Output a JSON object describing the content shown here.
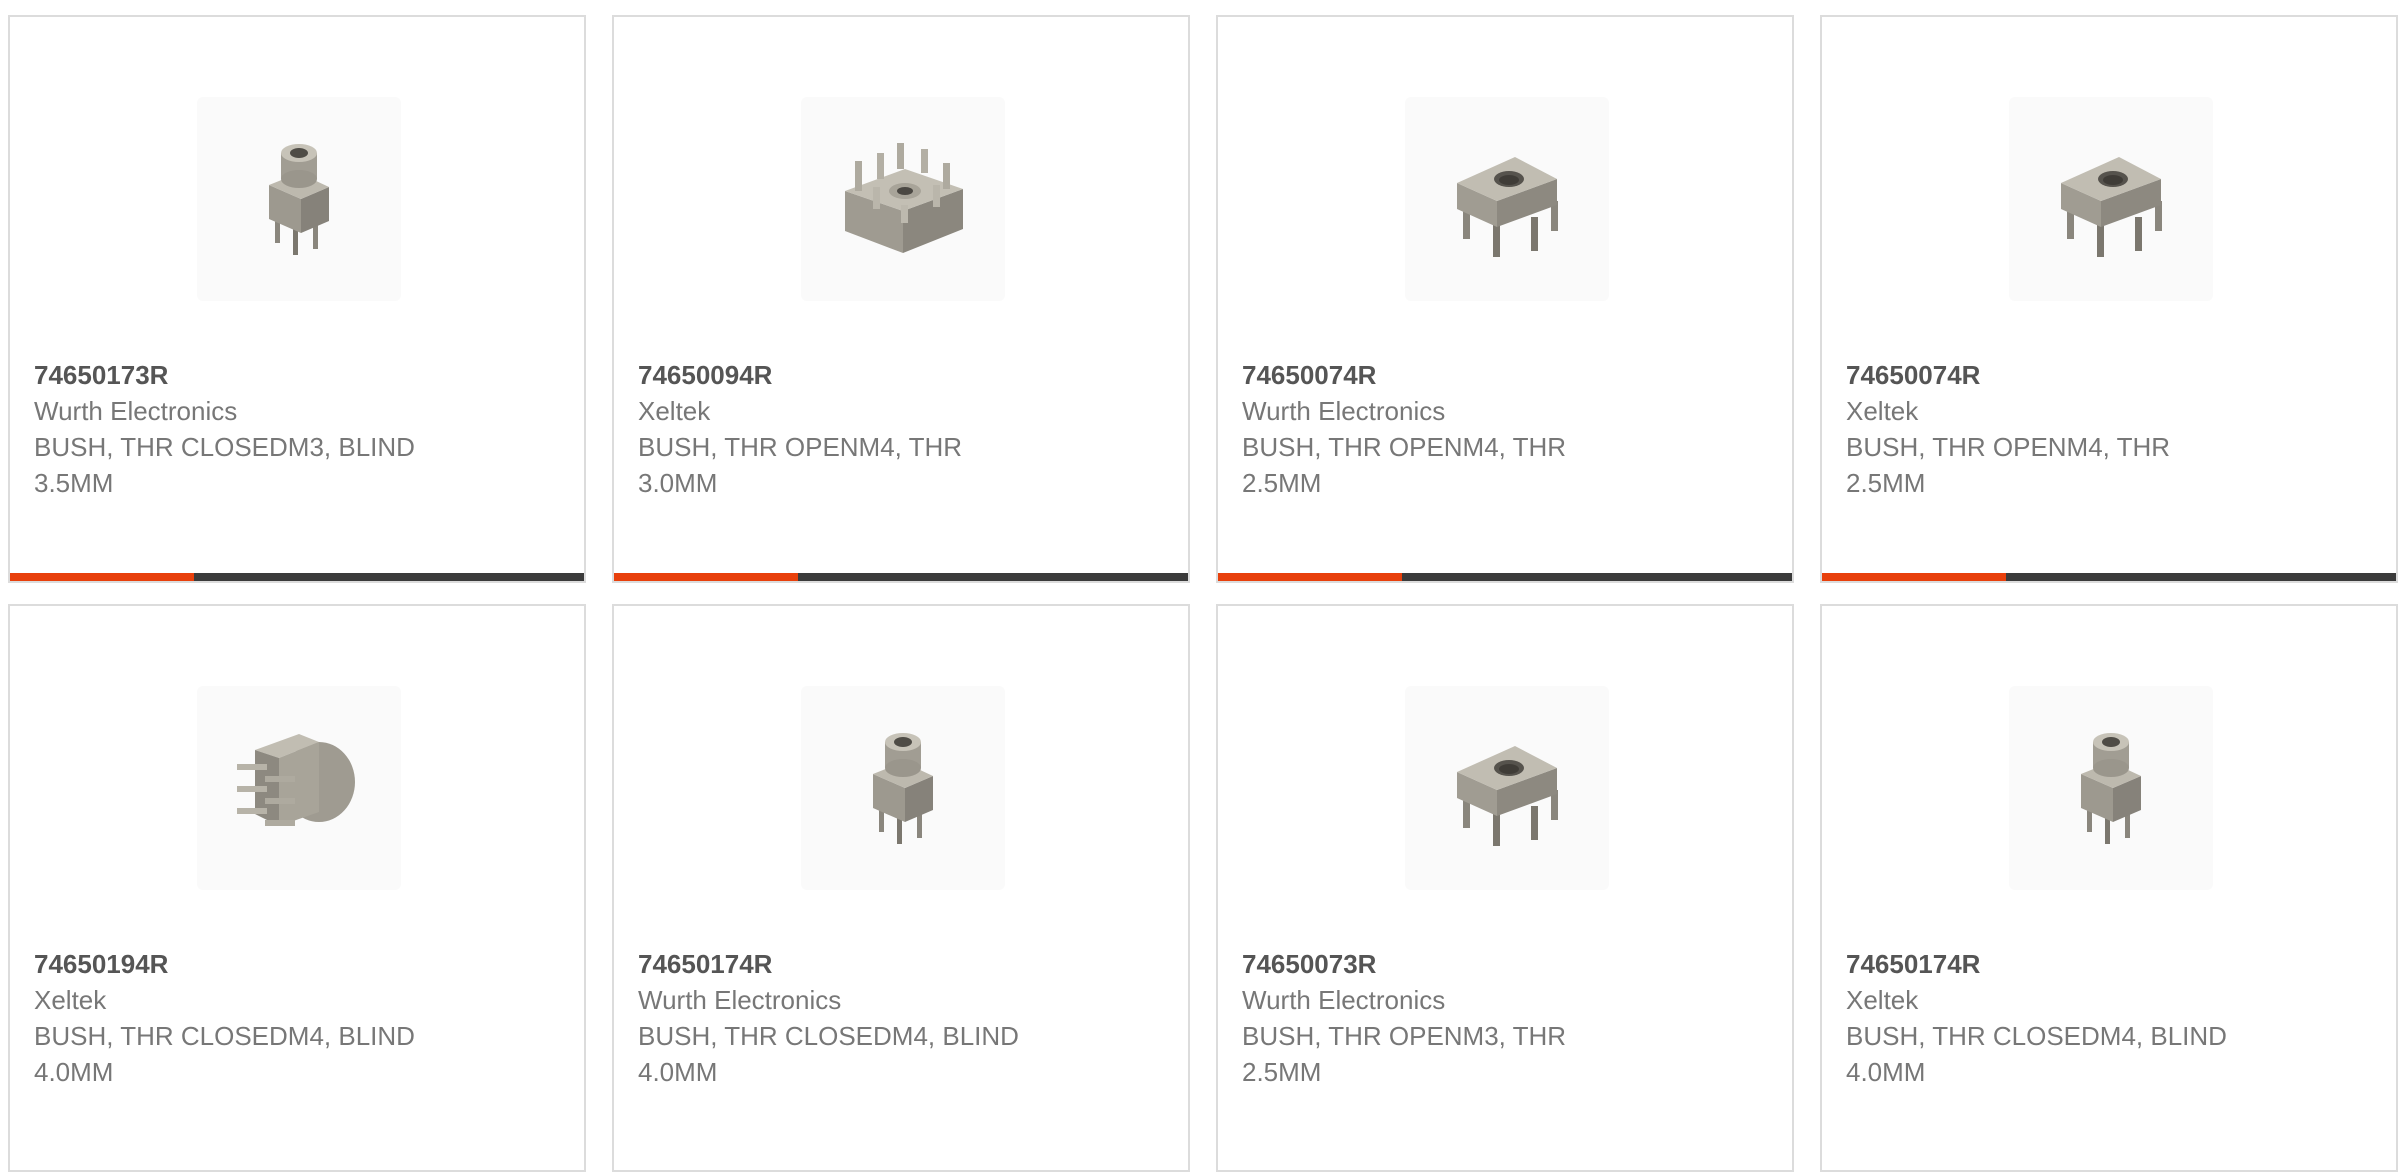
{
  "accent_color": "#e8400c",
  "bar_track_color": "#3b3b3b",
  "products": [
    {
      "part_number": "74650173R",
      "manufacturer": "Wurth Electronics",
      "description": "BUSH, THR CLOSEDM3, BLIND\n3.5MM",
      "icon": "closed-bush-small-icon",
      "progress_fraction": 0.32
    },
    {
      "part_number": "74650094R",
      "manufacturer": "Xeltek",
      "description": "BUSH, THR OPENM4, THR\n3.0MM",
      "icon": "multi-pin-bush-icon",
      "progress_fraction": 0.32
    },
    {
      "part_number": "74650074R",
      "manufacturer": "Wurth Electronics",
      "description": "BUSH, THR OPENM4, THR\n2.5MM",
      "icon": "open-bush-square-icon",
      "progress_fraction": 0.32
    },
    {
      "part_number": "74650074R",
      "manufacturer": "Xeltek",
      "description": "BUSH, THR OPENM4, THR\n2.5MM",
      "icon": "open-bush-square-icon",
      "progress_fraction": 0.32
    },
    {
      "part_number": "74650194R",
      "manufacturer": "Xeltek",
      "description": "BUSH, THR CLOSEDM4, BLIND\n4.0MM",
      "icon": "right-angle-bush-icon",
      "progress_fraction": 0
    },
    {
      "part_number": "74650174R",
      "manufacturer": "Wurth Electronics",
      "description": "BUSH, THR CLOSEDM4, BLIND\n4.0MM",
      "icon": "closed-bush-small-icon",
      "progress_fraction": 0
    },
    {
      "part_number": "74650073R",
      "manufacturer": "Wurth Electronics",
      "description": "BUSH, THR OPENM3, THR\n2.5MM",
      "icon": "open-bush-square-icon",
      "progress_fraction": 0
    },
    {
      "part_number": "74650174R",
      "manufacturer": "Xeltek",
      "description": "BUSH, THR CLOSEDM4, BLIND\n4.0MM",
      "icon": "closed-bush-small-icon",
      "progress_fraction": 0
    }
  ]
}
